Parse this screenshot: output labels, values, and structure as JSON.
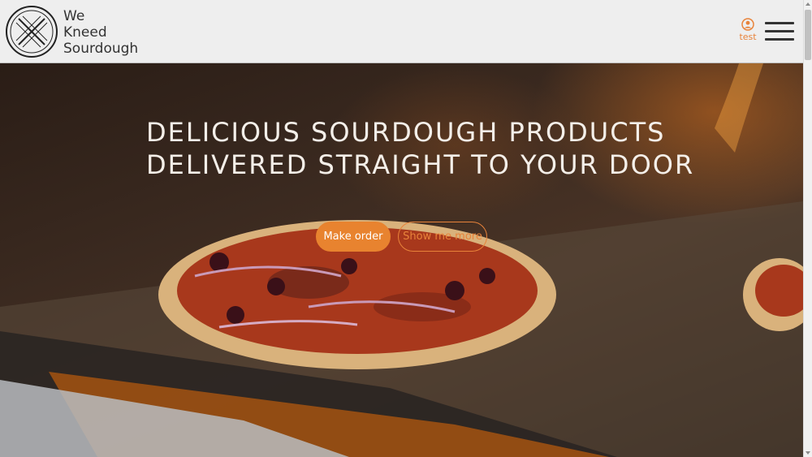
{
  "brand": {
    "name_lines": [
      "We",
      "Kneed",
      "Sourdough"
    ]
  },
  "header": {
    "account_label": "test",
    "account_icon": "user-circle-icon",
    "menu_icon": "hamburger-menu-icon"
  },
  "hero": {
    "headline_lines": [
      "DELICIOUS SOURDOUGH PRODUCTS",
      "DELIVERED STRAIGHT TO YOUR DOOR"
    ],
    "primary_button": "Make order",
    "secondary_button": "Show me more"
  },
  "colors": {
    "accent": "#e8833a",
    "header_bg": "#eeeeee",
    "text_dark": "#333333",
    "headline": "#f4efe9"
  }
}
